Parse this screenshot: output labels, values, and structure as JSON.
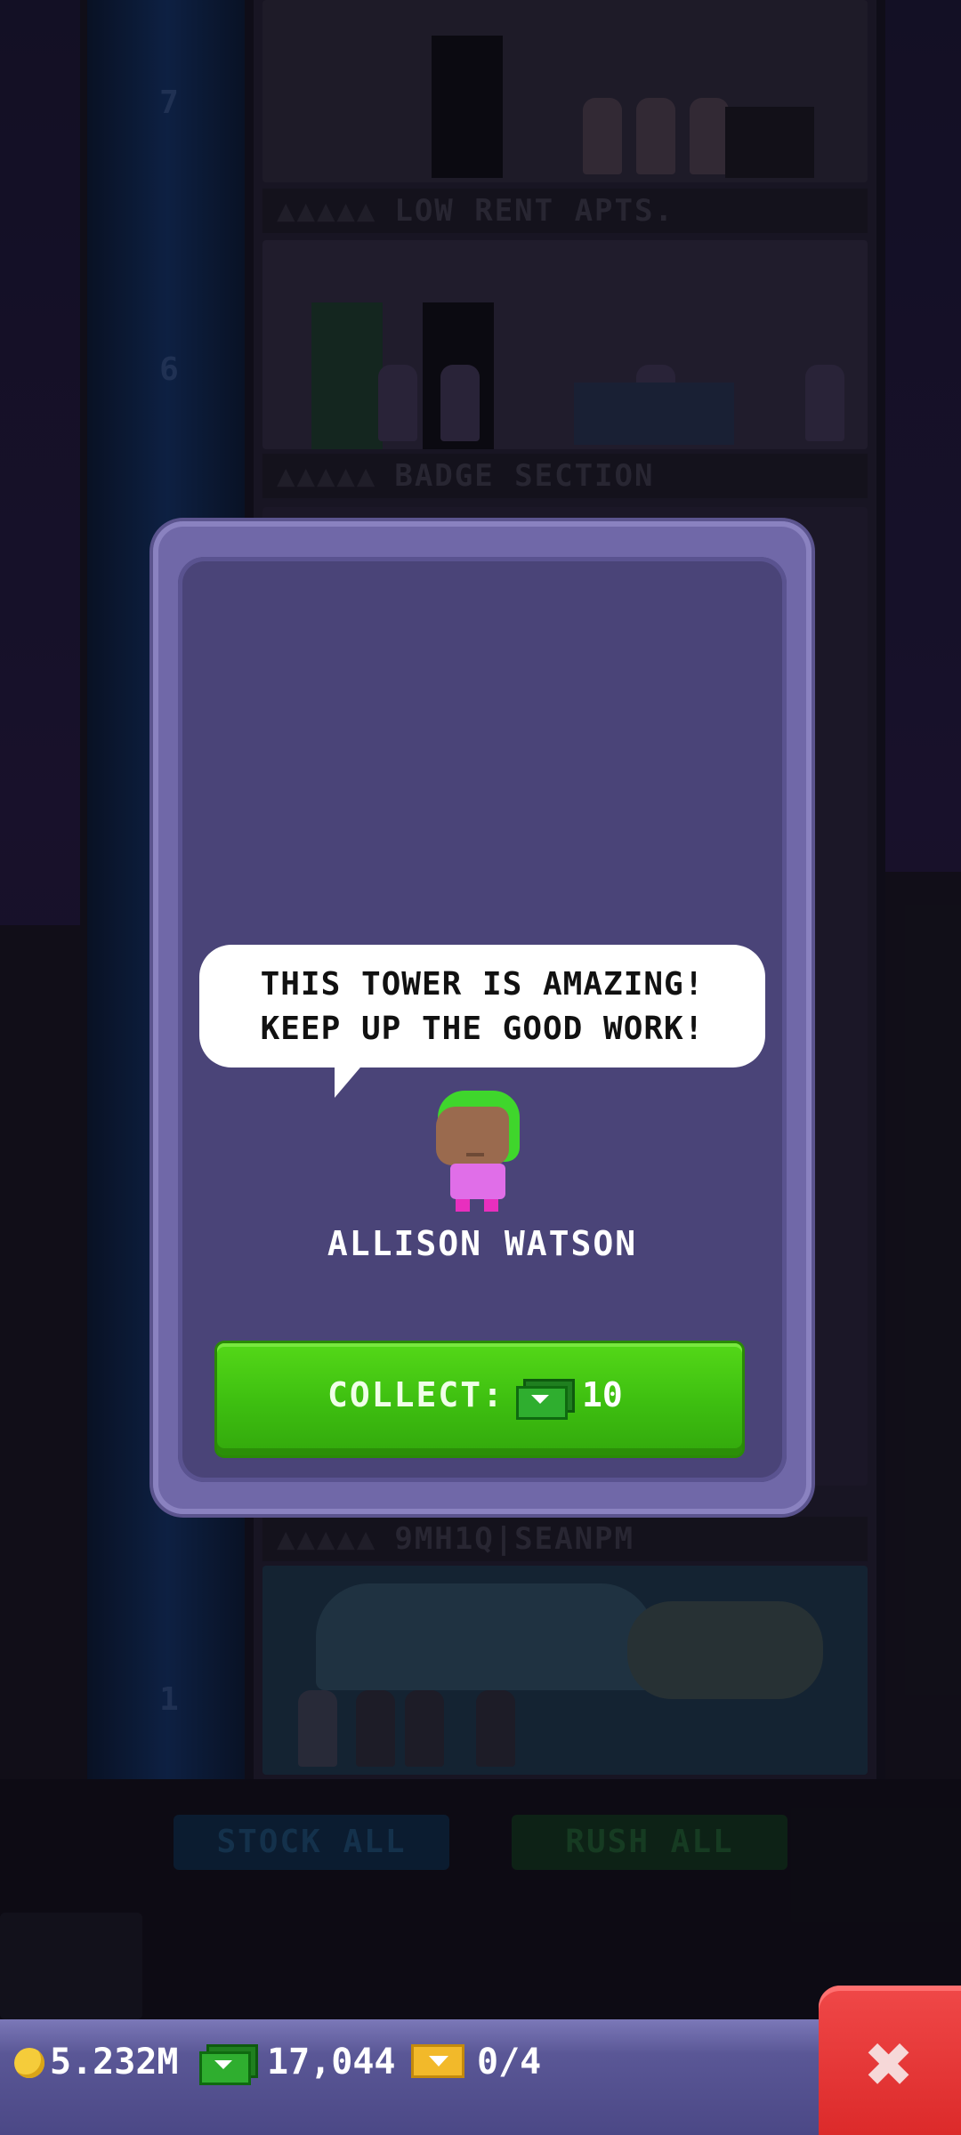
{
  "floors": {
    "top_number": "7",
    "mid_number": "6",
    "bottom_number": "1",
    "label_top": "LOW RENT APTS.",
    "label_mid": "BADGE SECTION",
    "label_bottom": "9MH1Q|SEANPM",
    "occupant_dots": "▲▲▲▲▲"
  },
  "toolbar": {
    "stock_all": "STOCK ALL",
    "rush_all": "RUSH ALL"
  },
  "dialog": {
    "speech_line1": "THIS TOWER IS AMAZING!",
    "speech_line2": "KEEP UP THE GOOD WORK!",
    "character_name": "ALLISON WATSON",
    "collect_label": "COLLECT:",
    "collect_amount": "10",
    "collect_icon": "bux-icon"
  },
  "status": {
    "coins": "5.232M",
    "bux": "17,044",
    "tickets": "0/4",
    "coin_icon": "coin-icon",
    "bux_icon": "bux-icon",
    "ticket_icon": "golden-ticket-icon"
  },
  "colors": {
    "dialog_bg": "#4a4478",
    "dialog_frame": "#7068a8",
    "collect_green": "#45c812",
    "close_red": "#e23434",
    "status_bar": "#5a5796"
  }
}
